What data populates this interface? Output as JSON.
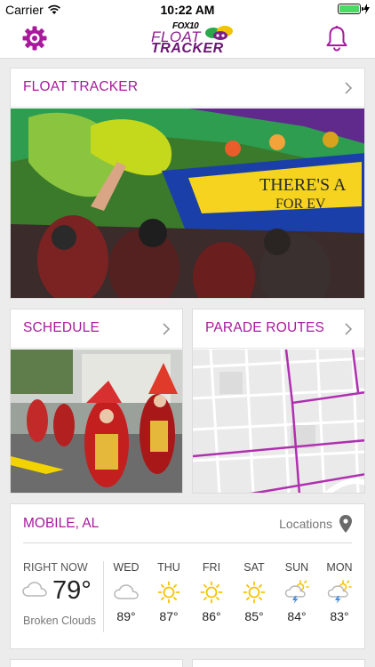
{
  "status_bar": {
    "carrier": "Carrier",
    "time": "10:22 AM"
  },
  "nav": {
    "logo_line1": "FOX10",
    "logo_line2": "FLOAT",
    "logo_line3": "TRACKER"
  },
  "cards": {
    "float_tracker": {
      "title": "FLOAT TRACKER"
    },
    "schedule": {
      "title": "SCHEDULE"
    },
    "parade_routes": {
      "title": "PARADE ROUTES"
    }
  },
  "banner": {
    "sign_line1": "THERE'S A",
    "sign_line2": "FOR EV"
  },
  "weather": {
    "city": "MOBILE, AL",
    "locations_label": "Locations",
    "now_label": "RIGHT NOW",
    "now_temp": "79°",
    "now_condition": "Broken Clouds",
    "forecast": [
      {
        "day": "WED",
        "temp": "89°",
        "icon": "cloud-icon"
      },
      {
        "day": "THU",
        "temp": "87°",
        "icon": "sun-icon"
      },
      {
        "day": "FRI",
        "temp": "86°",
        "icon": "sun-icon"
      },
      {
        "day": "SAT",
        "temp": "85°",
        "icon": "sun-icon"
      },
      {
        "day": "SUN",
        "temp": "84°",
        "icon": "thunderstorm-icon"
      },
      {
        "day": "MON",
        "temp": "83°",
        "icon": "thunderstorm-icon"
      }
    ]
  },
  "colors": {
    "accent": "#a8199c",
    "sun": "#f5c400",
    "cloud": "#b7b7b7",
    "bolt": "#4a90e2"
  }
}
